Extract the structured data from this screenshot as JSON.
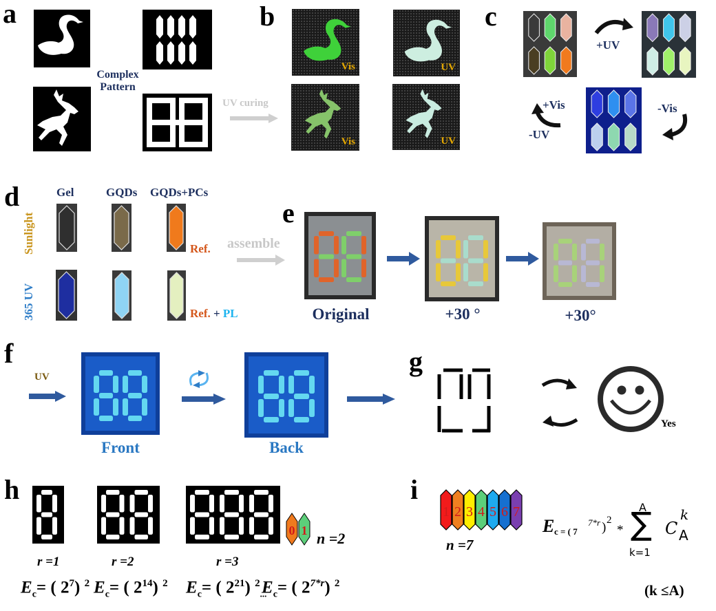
{
  "panels": {
    "a": {
      "label": "a",
      "caption_line1": "Complex",
      "caption_line2": "Pattern",
      "masks": [
        "swan-mask",
        "hexagon-array-mask",
        "deer-mask",
        "seven-segment-88-mask"
      ]
    },
    "ab_arrow_label": "UV curing",
    "b": {
      "label": "b",
      "tiles": [
        {
          "shape": "swan",
          "light": "Vis",
          "color": "#3fd13a"
        },
        {
          "shape": "swan",
          "light": "UV",
          "color": "#cdeee0"
        },
        {
          "shape": "deer",
          "light": "Vis",
          "color": "#86c36a"
        },
        {
          "shape": "deer",
          "light": "UV",
          "color": "#c9ece0"
        }
      ]
    },
    "c": {
      "label": "c",
      "arrow_top": "+UV",
      "arrow_right": "-Vis",
      "arrow_left_top": "+Vis",
      "arrow_left_bottom": "-UV",
      "state1_colors": [
        "#3a3a3a",
        "#5fd66c",
        "#e9b3a0",
        "#4a3e22",
        "#7fd43a",
        "#f07a1e"
      ],
      "state2_colors": [
        "#8a79b8",
        "#40c6ec",
        "#ccd0e6",
        "#cfeee6",
        "#9ff06a",
        "#e8f5c0"
      ],
      "state3_colors": [
        "#2e3ee0",
        "#2f8ff0",
        "#5a74e8",
        "#bcd0ee",
        "#8ed8b0",
        "#b8dac8"
      ]
    },
    "d": {
      "label": "d",
      "columns": [
        "Gel",
        "GQDs",
        "GQDs+PCs"
      ],
      "rows": [
        "Sunlight",
        "365 UV"
      ],
      "row1_colors": [
        "#2f2f2f",
        "#7a6a4a",
        "#f07a1c"
      ],
      "row2_colors": [
        "#1e2ea0",
        "#8fd4f4",
        "#e4f0c0"
      ],
      "note1": "Ref.",
      "note2_ref": "Ref.",
      "note2_plus": "+",
      "note2_pl": "PL",
      "arrow_label": "assemble"
    },
    "e": {
      "label": "e",
      "captions": [
        "Original",
        "+30 °",
        "+30°"
      ]
    },
    "f": {
      "label": "f",
      "arrow_label": "UV",
      "captions": [
        "Front",
        "Back"
      ],
      "rotate_icon": "rotate-icon"
    },
    "g": {
      "label": "g",
      "result_label": "Yes"
    },
    "h": {
      "label": "h",
      "r_labels": [
        "r =1",
        "r =2",
        "r =3"
      ],
      "n_label": "n =2",
      "mini_digits": [
        "0",
        "1"
      ],
      "equations": [
        {
          "base": "2",
          "exp": "7",
          "outer": "2"
        },
        {
          "base": "2",
          "exp": "14",
          "outer": "2"
        },
        {
          "base": "2",
          "exp": "21",
          "outer": "2"
        },
        {
          "base": "2",
          "exp": "7*r",
          "outer": "2"
        }
      ],
      "ellipsis": "..."
    },
    "i": {
      "label": "i",
      "digits": [
        "1",
        "2",
        "3",
        "4",
        "5",
        "6",
        "7"
      ],
      "digit_colors": [
        "#f21b1b",
        "#f08020",
        "#ffee00",
        "#5ccf7a",
        "#1eaaef",
        "#1670d0",
        "#7a3fb0"
      ],
      "n_label": "n =7",
      "formula_lhs": "E",
      "formula_sub": "c = ( 7",
      "formula_sup": "7*r",
      "formula_tail": ")",
      "formula_outer": "2",
      "formula_mult": "*",
      "sum_upper": "A",
      "sum_lower": "k=1",
      "sum_term": "C",
      "term_sup": "k",
      "term_sub": "A",
      "condition": "(k ≤A)"
    }
  },
  "colors": {
    "navy": "#1d2f5e",
    "arrow_blue": "#2f5a9e",
    "gold": "#e5a800",
    "ref_orange": "#d4561a",
    "pl_cyan": "#1eb4ef",
    "sunlight": "#c9951e",
    "uv_blue": "#2f7ec8"
  }
}
